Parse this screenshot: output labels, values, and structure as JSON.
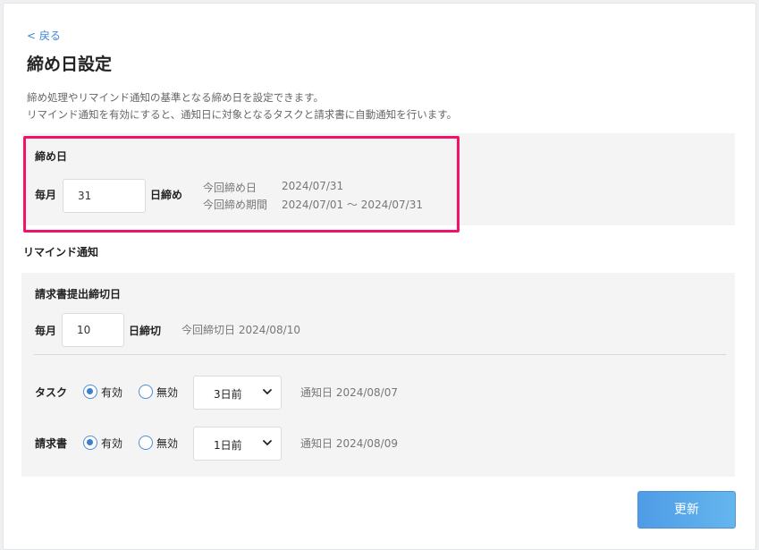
{
  "nav": {
    "back_label": "< 戻る"
  },
  "page": {
    "title": "締め日設定",
    "description_line1": "締め処理やリマインド通知の基準となる締め日を設定できます。",
    "description_line2": "リマインド通知を有効にすると、通知日に対象となるタスクと請求書に自動通知を行います。"
  },
  "closing": {
    "section_label": "締め日",
    "prefix": "毎月",
    "day_value": "31",
    "suffix": "日締め",
    "current_date_label": "今回締め日",
    "current_date_value": "2024/07/31",
    "current_period_label": "今回締め期間",
    "current_period_value": "2024/07/01 ～ 2024/07/31"
  },
  "remind": {
    "section_title": "リマインド通知",
    "invoice_deadline": {
      "label": "請求書提出締切日",
      "prefix": "毎月",
      "day_value": "10",
      "suffix": "日締切",
      "current_text": "今回締切日 2024/08/10"
    },
    "task": {
      "label": "タスク",
      "enabled_label": "有効",
      "disabled_label": "無効",
      "selected": "enabled",
      "offset_value": "3日前",
      "notify_text": "通知日 2024/08/07"
    },
    "invoice": {
      "label": "請求書",
      "enabled_label": "有効",
      "disabled_label": "無効",
      "selected": "enabled",
      "offset_value": "1日前",
      "notify_text": "通知日 2024/08/09"
    }
  },
  "actions": {
    "update_label": "更新"
  },
  "colors": {
    "accent": "#3b86d6",
    "highlight": "#f0136a",
    "button_start": "#4f9be6",
    "button_end": "#64b6ee"
  },
  "icons": {
    "select_arrow": "chevron-down-icon"
  }
}
